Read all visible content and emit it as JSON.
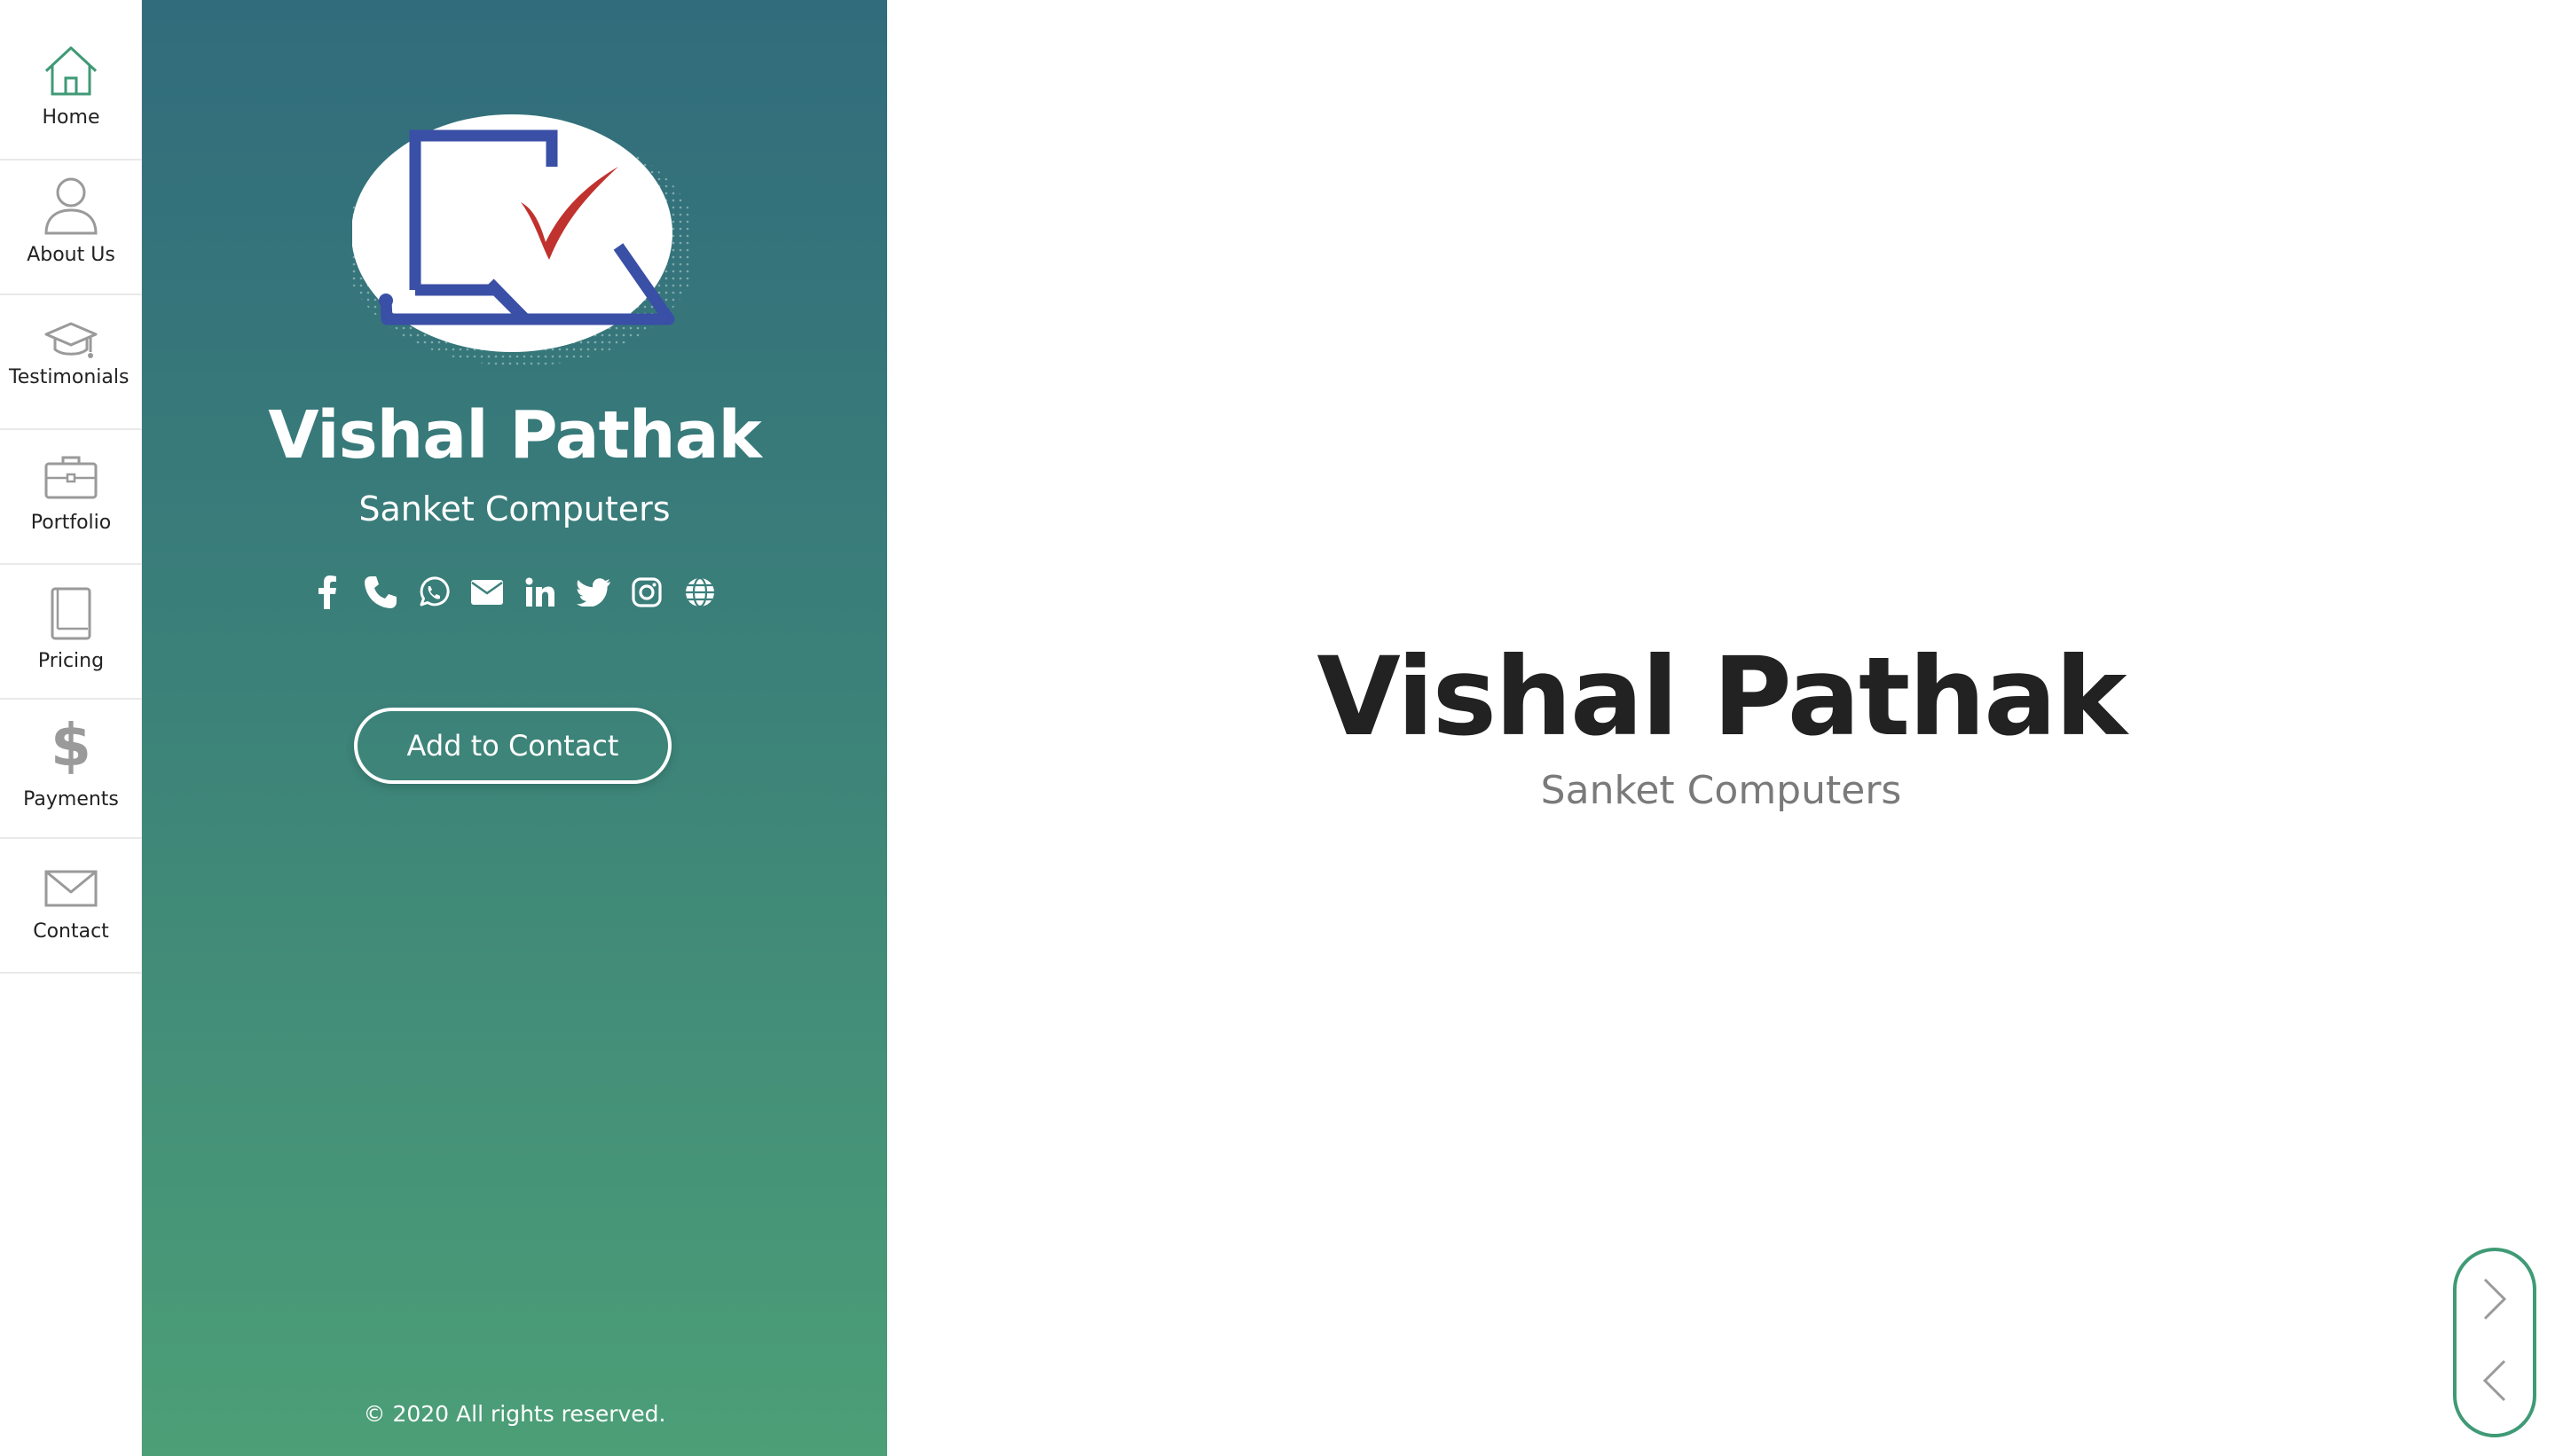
{
  "nav": {
    "items": [
      {
        "label": "Home",
        "icon": "home-icon"
      },
      {
        "label": "About Us",
        "icon": "user-icon"
      },
      {
        "label": "Testimonials",
        "icon": "graduation-cap-icon"
      },
      {
        "label": "Portfolio",
        "icon": "briefcase-icon"
      },
      {
        "label": "Pricing",
        "icon": "book-icon"
      },
      {
        "label": "Payments",
        "icon": "dollar-icon"
      },
      {
        "label": "Contact",
        "icon": "envelope-icon"
      }
    ],
    "accent_color": "#3f9a76"
  },
  "profile": {
    "name": "Vishal Pathak",
    "company": "Sanket Computers",
    "add_contact_label": "Add to Contact",
    "socials": [
      "facebook-icon",
      "phone-icon",
      "whatsapp-icon",
      "email-icon",
      "linkedin-icon",
      "twitter-icon",
      "instagram-icon",
      "globe-icon"
    ],
    "copyright": "© 2020 All rights reserved.",
    "gradient_top": "#316c7c",
    "gradient_bottom": "#4c9f77"
  },
  "hero": {
    "name": "Vishal Pathak",
    "company": "Sanket Computers"
  },
  "pager": {
    "next_icon": "chevron-right-icon",
    "prev_icon": "chevron-left-icon"
  }
}
